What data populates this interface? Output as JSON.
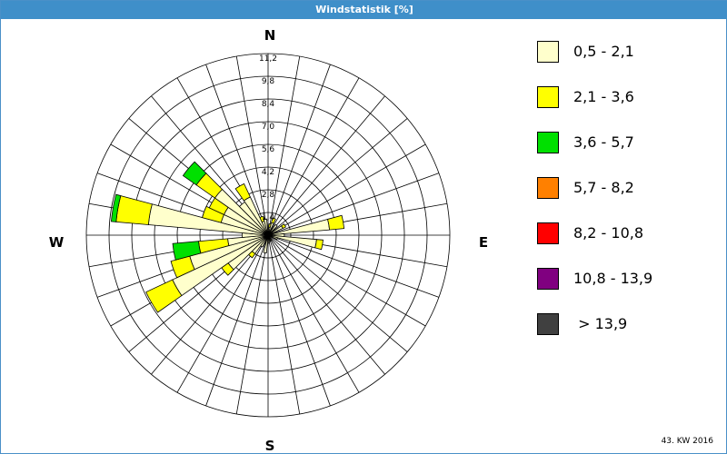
{
  "window": {
    "title": "Windstatistik [%]"
  },
  "footer": {
    "week_label": "43. KW 2016"
  },
  "compass": {
    "north": "N",
    "east": "E",
    "south": "S",
    "west": "W"
  },
  "legend": [
    {
      "label": "0,5 - 2,1",
      "color": "#ffffcc"
    },
    {
      "label": "2,1 - 3,6",
      "color": "#ffff00"
    },
    {
      "label": "3,6 - 5,7",
      "color": "#00e000"
    },
    {
      "label": "5,7 - 8,2",
      "color": "#ff8000"
    },
    {
      "label": "8,2 - 10,8",
      "color": "#ff0000"
    },
    {
      "label": "10,8 - 13,9",
      "color": "#800080"
    },
    {
      "label": " > 13,9",
      "color": "#404040"
    }
  ],
  "chart_data": {
    "type": "wind-rose",
    "title": "Windstatistik [%]",
    "radial_max": 11.2,
    "radial_ticks": [
      "1,4",
      "2,8",
      "4,2",
      "5,6",
      "7,0",
      "8,4",
      "9,8",
      "11,2"
    ],
    "radial_tick_values": [
      1.4,
      2.8,
      4.2,
      5.6,
      7.0,
      8.4,
      9.8,
      11.2
    ],
    "sector_width_deg": 10,
    "sectors": [
      {
        "dir": 10,
        "values": [
          0.5,
          0.2
        ]
      },
      {
        "dir": 20,
        "values": [
          0.8,
          0.3
        ]
      },
      {
        "dir": 40,
        "values": [
          0.8
        ]
      },
      {
        "dir": 60,
        "values": [
          1.0,
          0.2
        ]
      },
      {
        "dir": 80,
        "values": [
          3.8,
          0.9
        ]
      },
      {
        "dir": 90,
        "values": [
          1.0
        ]
      },
      {
        "dir": 100,
        "values": [
          3.0,
          0.4
        ]
      },
      {
        "dir": 110,
        "values": [
          0.6
        ]
      },
      {
        "dir": 150,
        "values": [
          0.4
        ]
      },
      {
        "dir": 170,
        "values": [
          0.4
        ]
      },
      {
        "dir": 180,
        "values": [
          0.5
        ]
      },
      {
        "dir": 190,
        "values": [
          1.1
        ]
      },
      {
        "dir": 210,
        "values": [
          0.8
        ]
      },
      {
        "dir": 220,
        "values": [
          1.4,
          0.3
        ]
      },
      {
        "dir": 230,
        "values": [
          3.0,
          0.5
        ]
      },
      {
        "dir": 240,
        "values": [
          6.5,
          1.8
        ]
      },
      {
        "dir": 250,
        "values": [
          5.0,
          1.2
        ]
      },
      {
        "dir": 260,
        "values": [
          2.5,
          1.8,
          1.6
        ]
      },
      {
        "dir": 270,
        "values": [
          1.6
        ]
      },
      {
        "dir": 280,
        "values": [
          7.4,
          2.0,
          0.3
        ]
      },
      {
        "dir": 290,
        "values": [
          3.0,
          1.2
        ]
      },
      {
        "dir": 300,
        "values": [
          3.0,
          1.0
        ]
      },
      {
        "dir": 310,
        "values": [
          4.0,
          1.4,
          1.0
        ]
      },
      {
        "dir": 320,
        "values": [
          2.5
        ]
      },
      {
        "dir": 330,
        "values": [
          2.6,
          0.9
        ]
      },
      {
        "dir": 340,
        "values": [
          0.9,
          0.3
        ]
      },
      {
        "dir": 350,
        "values": [
          1.0
        ]
      }
    ]
  }
}
